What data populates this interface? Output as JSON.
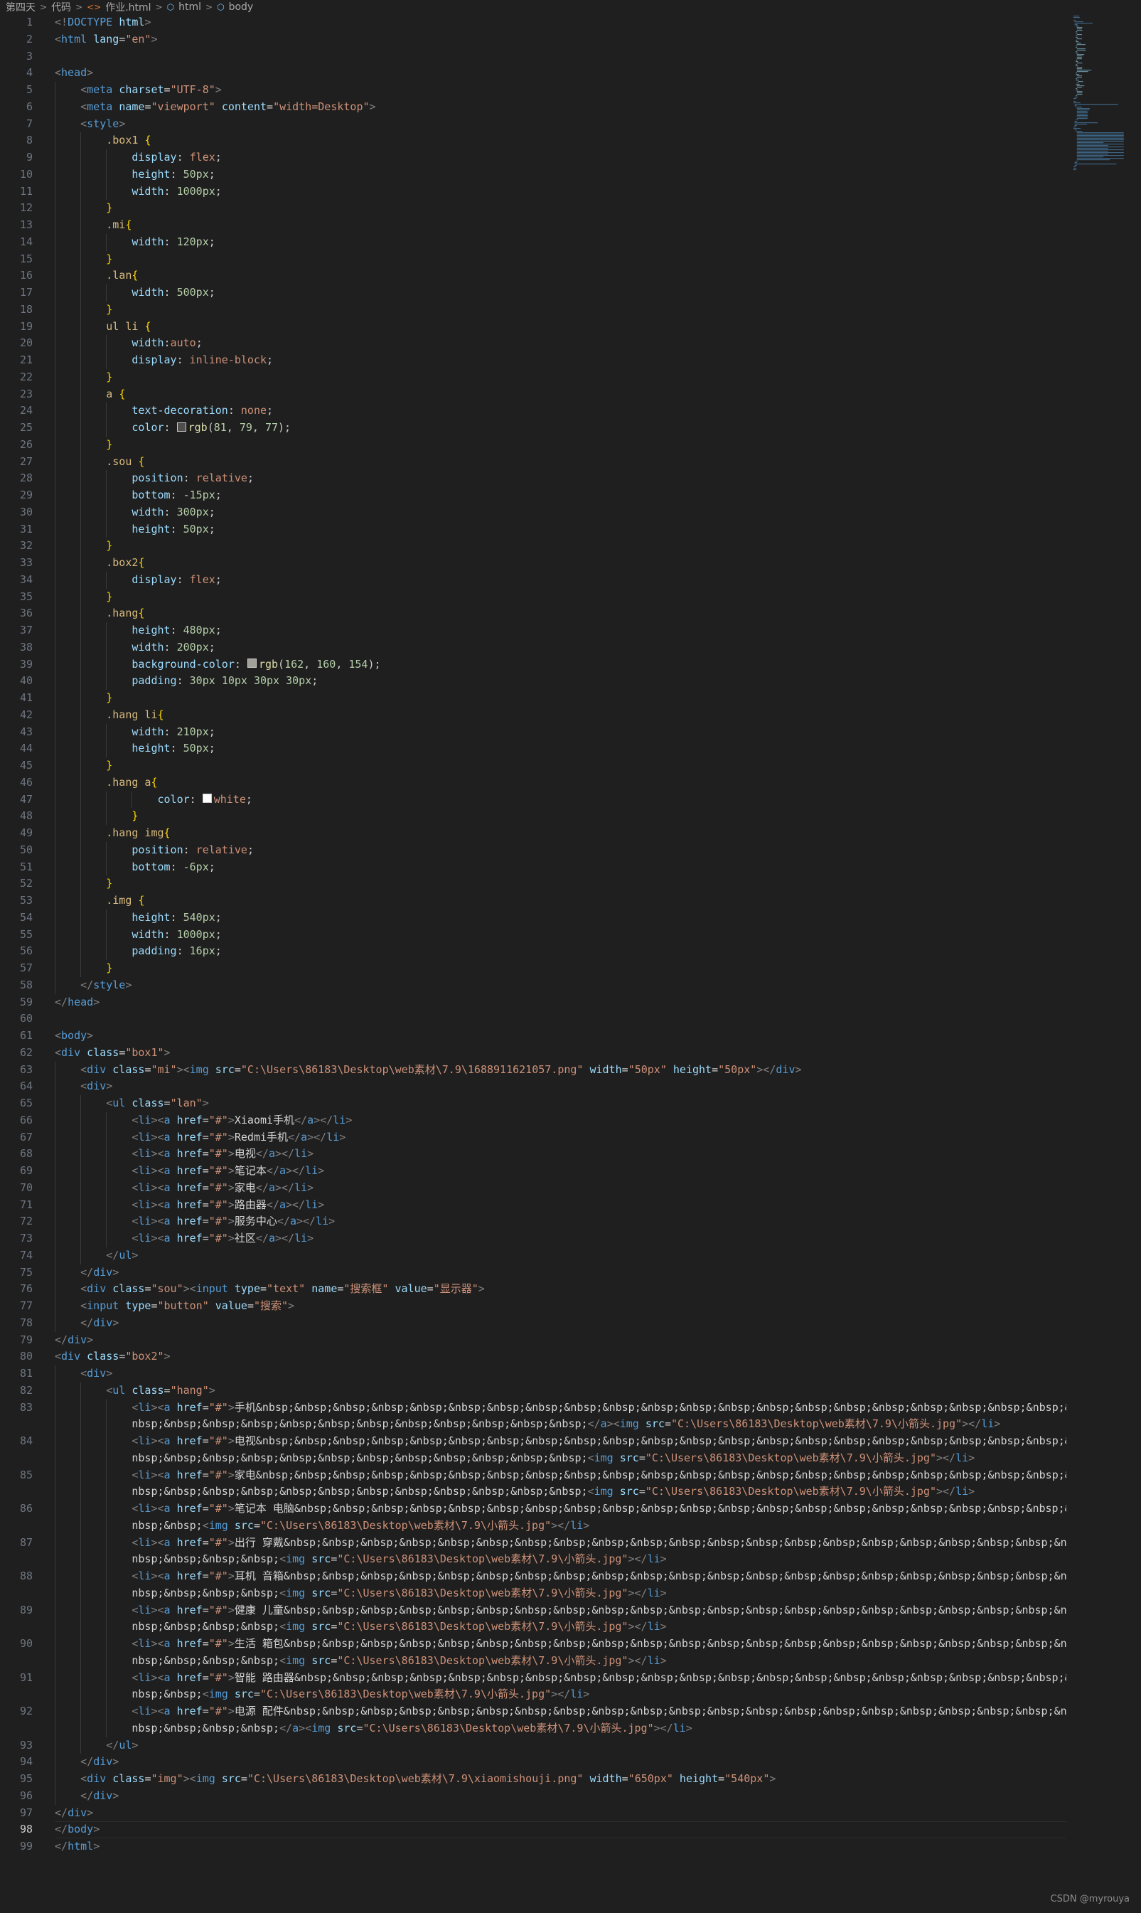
{
  "breadcrumb": [
    "第四天",
    "代码",
    "作业.html",
    "html",
    "body"
  ],
  "active_line": 98,
  "watermark": "CSDN @myrouya",
  "colors": {
    "background": "#1f1f1f",
    "tag_name": "#569cd6",
    "attribute": "#9cdcfe",
    "string": "#ce9178",
    "selector": "#d7ba7d",
    "brace": "#ffd700",
    "number": "#b5cea8",
    "swatch_1": "#514f4d",
    "swatch_2": "#a2a09a",
    "swatch_3": "#ffffff"
  },
  "lines": [
    {
      "n": 1,
      "text": "<!DOCTYPE html>"
    },
    {
      "n": 2,
      "text": "<html lang=\"en\">"
    },
    {
      "n": 3,
      "text": ""
    },
    {
      "n": 4,
      "text": "<head>"
    },
    {
      "n": 5,
      "text": "    <meta charset=\"UTF-8\">"
    },
    {
      "n": 6,
      "text": "    <meta name=\"viewport\" content=\"width=Desktop\">"
    },
    {
      "n": 7,
      "text": "    <style>"
    },
    {
      "n": 8,
      "text": "        .box1 {"
    },
    {
      "n": 9,
      "text": "            display: flex;"
    },
    {
      "n": 10,
      "text": "            height: 50px;"
    },
    {
      "n": 11,
      "text": "            width: 1000px;"
    },
    {
      "n": 12,
      "text": "        }"
    },
    {
      "n": 13,
      "text": "        .mi{"
    },
    {
      "n": 14,
      "text": "            width: 120px;"
    },
    {
      "n": 15,
      "text": "        }"
    },
    {
      "n": 16,
      "text": "        .lan{"
    },
    {
      "n": 17,
      "text": "            width: 500px;"
    },
    {
      "n": 18,
      "text": "        }"
    },
    {
      "n": 19,
      "text": "        ul li {"
    },
    {
      "n": 20,
      "text": "            width:auto;"
    },
    {
      "n": 21,
      "text": "            display: inline-block;"
    },
    {
      "n": 22,
      "text": "        }"
    },
    {
      "n": 23,
      "text": "        a {"
    },
    {
      "n": 24,
      "text": "            text-decoration: none;"
    },
    {
      "n": 25,
      "text": "            color: rgb(81, 79, 77);",
      "swatch": "swatch_1"
    },
    {
      "n": 26,
      "text": "        }"
    },
    {
      "n": 27,
      "text": "        .sou {"
    },
    {
      "n": 28,
      "text": "            position: relative;"
    },
    {
      "n": 29,
      "text": "            bottom: -15px;"
    },
    {
      "n": 30,
      "text": "            width: 300px;"
    },
    {
      "n": 31,
      "text": "            height: 50px;"
    },
    {
      "n": 32,
      "text": "        }"
    },
    {
      "n": 33,
      "text": "        .box2{"
    },
    {
      "n": 34,
      "text": "            display: flex;"
    },
    {
      "n": 35,
      "text": "        }"
    },
    {
      "n": 36,
      "text": "        .hang{"
    },
    {
      "n": 37,
      "text": "            height: 480px;"
    },
    {
      "n": 38,
      "text": "            width: 200px;"
    },
    {
      "n": 39,
      "text": "            background-color: rgb(162, 160, 154);",
      "swatch": "swatch_2"
    },
    {
      "n": 40,
      "text": "            padding: 30px 10px 30px 30px;"
    },
    {
      "n": 41,
      "text": "        }"
    },
    {
      "n": 42,
      "text": "        .hang li{"
    },
    {
      "n": 43,
      "text": "            width: 210px;"
    },
    {
      "n": 44,
      "text": "            height: 50px;"
    },
    {
      "n": 45,
      "text": "        }"
    },
    {
      "n": 46,
      "text": "        .hang a{"
    },
    {
      "n": 47,
      "text": "                color: white;",
      "swatch": "swatch_3"
    },
    {
      "n": 48,
      "text": "            }"
    },
    {
      "n": 49,
      "text": "        .hang img{"
    },
    {
      "n": 50,
      "text": "            position: relative;"
    },
    {
      "n": 51,
      "text": "            bottom: -6px;"
    },
    {
      "n": 52,
      "text": "        }"
    },
    {
      "n": 53,
      "text": "        .img {"
    },
    {
      "n": 54,
      "text": "            height: 540px;"
    },
    {
      "n": 55,
      "text": "            width: 1000px;"
    },
    {
      "n": 56,
      "text": "            padding: 16px;"
    },
    {
      "n": 57,
      "text": "        }"
    },
    {
      "n": 58,
      "text": "    </style>"
    },
    {
      "n": 59,
      "text": "</head>"
    },
    {
      "n": 60,
      "text": ""
    },
    {
      "n": 61,
      "text": "<body>"
    },
    {
      "n": 62,
      "text": "<div class=\"box1\">"
    },
    {
      "n": 63,
      "text": "    <div class=\"mi\"><img src=\"C:\\Users\\86183\\Desktop\\web素材\\7.9\\1688911621057.png\" width=\"50px\" height=\"50px\"></div>"
    },
    {
      "n": 64,
      "text": "    <div>"
    },
    {
      "n": 65,
      "text": "        <ul class=\"lan\">"
    },
    {
      "n": 66,
      "text": "            <li><a href=\"#\">Xiaomi手机</a></li>"
    },
    {
      "n": 67,
      "text": "            <li><a href=\"#\">Redmi手机</a></li>"
    },
    {
      "n": 68,
      "text": "            <li><a href=\"#\">电视</a></li>"
    },
    {
      "n": 69,
      "text": "            <li><a href=\"#\">笔记本</a></li>"
    },
    {
      "n": 70,
      "text": "            <li><a href=\"#\">家电</a></li>"
    },
    {
      "n": 71,
      "text": "            <li><a href=\"#\">路由器</a></li>"
    },
    {
      "n": 72,
      "text": "            <li><a href=\"#\">服务中心</a></li>"
    },
    {
      "n": 73,
      "text": "            <li><a href=\"#\">社区</a></li>"
    },
    {
      "n": 74,
      "text": "        </ul>"
    },
    {
      "n": 75,
      "text": "    </div>"
    },
    {
      "n": 76,
      "text": "    <div class=\"sou\"><input type=\"text\" name=\"搜索框\" value=\"显示器\">"
    },
    {
      "n": 77,
      "text": "    <input type=\"button\" value=\"搜索\">"
    },
    {
      "n": 78,
      "text": "    </div>"
    },
    {
      "n": 79,
      "text": "</div>"
    },
    {
      "n": 80,
      "text": "<div class=\"box2\">"
    },
    {
      "n": 81,
      "text": "    <div>"
    },
    {
      "n": 82,
      "text": "        <ul class=\"hang\">"
    },
    {
      "n": 83,
      "text": "            <li><a href=\"#\">手机&nbsp;&nbsp;&nbsp;&nbsp;&nbsp;&nbsp;&nbsp;&nbsp;&nbsp;&nbsp;&nbsp;&nbsp;&nbsp;&nbsp;&nbsp;&nbsp;&nbsp;&nbsp;&nbsp;&nbsp;&nbsp;&nbsp;&"
    },
    {
      "n": null,
      "text": "            nbsp;&nbsp;&nbsp;&nbsp;&nbsp;&nbsp;&nbsp;&nbsp;&nbsp;&nbsp;&nbsp;&nbsp;</a><img src=\"C:\\Users\\86183\\Desktop\\web素材\\7.9\\小箭头.jpg\"></li>"
    },
    {
      "n": 84,
      "text": "            <li><a href=\"#\">电视&nbsp;&nbsp;&nbsp;&nbsp;&nbsp;&nbsp;&nbsp;&nbsp;&nbsp;&nbsp;&nbsp;&nbsp;&nbsp;&nbsp;&nbsp;&nbsp;&nbsp;&nbsp;&nbsp;&nbsp;&nbsp;&nbsp;&"
    },
    {
      "n": null,
      "text": "            nbsp;&nbsp;&nbsp;&nbsp;&nbsp;&nbsp;&nbsp;&nbsp;&nbsp;&nbsp;&nbsp;&nbsp;<img src=\"C:\\Users\\86183\\Desktop\\web素材\\7.9\\小箭头.jpg\"></li>"
    },
    {
      "n": 85,
      "text": "            <li><a href=\"#\">家电&nbsp;&nbsp;&nbsp;&nbsp;&nbsp;&nbsp;&nbsp;&nbsp;&nbsp;&nbsp;&nbsp;&nbsp;&nbsp;&nbsp;&nbsp;&nbsp;&nbsp;&nbsp;&nbsp;&nbsp;&nbsp;&nbsp;&"
    },
    {
      "n": null,
      "text": "            nbsp;&nbsp;&nbsp;&nbsp;&nbsp;&nbsp;&nbsp;&nbsp;&nbsp;&nbsp;&nbsp;&nbsp;<img src=\"C:\\Users\\86183\\Desktop\\web素材\\7.9\\小箭头.jpg\"></li>"
    },
    {
      "n": 86,
      "text": "            <li><a href=\"#\">笔记本 电脑&nbsp;&nbsp;&nbsp;&nbsp;&nbsp;&nbsp;&nbsp;&nbsp;&nbsp;&nbsp;&nbsp;&nbsp;&nbsp;&nbsp;&nbsp;&nbsp;&nbsp;&nbsp;&nbsp;&nbsp;&"
    },
    {
      "n": null,
      "text": "            nbsp;&nbsp;<img src=\"C:\\Users\\86183\\Desktop\\web素材\\7.9\\小箭头.jpg\"></li>"
    },
    {
      "n": 87,
      "text": "            <li><a href=\"#\">出行 穿戴&nbsp;&nbsp;&nbsp;&nbsp;&nbsp;&nbsp;&nbsp;&nbsp;&nbsp;&nbsp;&nbsp;&nbsp;&nbsp;&nbsp;&nbsp;&nbsp;&nbsp;&nbsp;&nbsp;&nbsp;&nbsp;&"
    },
    {
      "n": null,
      "text": "            nbsp;&nbsp;&nbsp;&nbsp;<img src=\"C:\\Users\\86183\\Desktop\\web素材\\7.9\\小箭头.jpg\"></li>"
    },
    {
      "n": 88,
      "text": "            <li><a href=\"#\">耳机 音箱&nbsp;&nbsp;&nbsp;&nbsp;&nbsp;&nbsp;&nbsp;&nbsp;&nbsp;&nbsp;&nbsp;&nbsp;&nbsp;&nbsp;&nbsp;&nbsp;&nbsp;&nbsp;&nbsp;&nbsp;&nbsp;&"
    },
    {
      "n": null,
      "text": "            nbsp;&nbsp;&nbsp;&nbsp;<img src=\"C:\\Users\\86183\\Desktop\\web素材\\7.9\\小箭头.jpg\"></li>"
    },
    {
      "n": 89,
      "text": "            <li><a href=\"#\">健康 儿童&nbsp;&nbsp;&nbsp;&nbsp;&nbsp;&nbsp;&nbsp;&nbsp;&nbsp;&nbsp;&nbsp;&nbsp;&nbsp;&nbsp;&nbsp;&nbsp;&nbsp;&nbsp;&nbsp;&nbsp;&nbsp;&"
    },
    {
      "n": null,
      "text": "            nbsp;&nbsp;&nbsp;&nbsp;<img src=\"C:\\Users\\86183\\Desktop\\web素材\\7.9\\小箭头.jpg\"></li>"
    },
    {
      "n": 90,
      "text": "            <li><a href=\"#\">生活 箱包&nbsp;&nbsp;&nbsp;&nbsp;&nbsp;&nbsp;&nbsp;&nbsp;&nbsp;&nbsp;&nbsp;&nbsp;&nbsp;&nbsp;&nbsp;&nbsp;&nbsp;&nbsp;&nbsp;&nbsp;&nbsp;&"
    },
    {
      "n": null,
      "text": "            nbsp;&nbsp;&nbsp;&nbsp;<img src=\"C:\\Users\\86183\\Desktop\\web素材\\7.9\\小箭头.jpg\"></li>"
    },
    {
      "n": 91,
      "text": "            <li><a href=\"#\">智能 路由器&nbsp;&nbsp;&nbsp;&nbsp;&nbsp;&nbsp;&nbsp;&nbsp;&nbsp;&nbsp;&nbsp;&nbsp;&nbsp;&nbsp;&nbsp;&nbsp;&nbsp;&nbsp;&nbsp;&nbsp;&"
    },
    {
      "n": null,
      "text": "            nbsp;&nbsp;<img src=\"C:\\Users\\86183\\Desktop\\web素材\\7.9\\小箭头.jpg\"></li>"
    },
    {
      "n": 92,
      "text": "            <li><a href=\"#\">电源 配件&nbsp;&nbsp;&nbsp;&nbsp;&nbsp;&nbsp;&nbsp;&nbsp;&nbsp;&nbsp;&nbsp;&nbsp;&nbsp;&nbsp;&nbsp;&nbsp;&nbsp;&nbsp;&nbsp;&nbsp;&nbsp;&"
    },
    {
      "n": null,
      "text": "            nbsp;&nbsp;&nbsp;&nbsp;</a><img src=\"C:\\Users\\86183\\Desktop\\web素材\\7.9\\小箭头.jpg\"></li>"
    },
    {
      "n": 93,
      "text": "        </ul>"
    },
    {
      "n": 94,
      "text": "    </div>"
    },
    {
      "n": 95,
      "text": "    <div class=\"img\"><img src=\"C:\\Users\\86183\\Desktop\\web素材\\7.9\\xiaomishouji.png\" width=\"650px\" height=\"540px\">"
    },
    {
      "n": 96,
      "text": "    </div>"
    },
    {
      "n": 97,
      "text": "</div>"
    },
    {
      "n": 98,
      "text": "</body>"
    },
    {
      "n": 99,
      "text": "</html>"
    }
  ]
}
